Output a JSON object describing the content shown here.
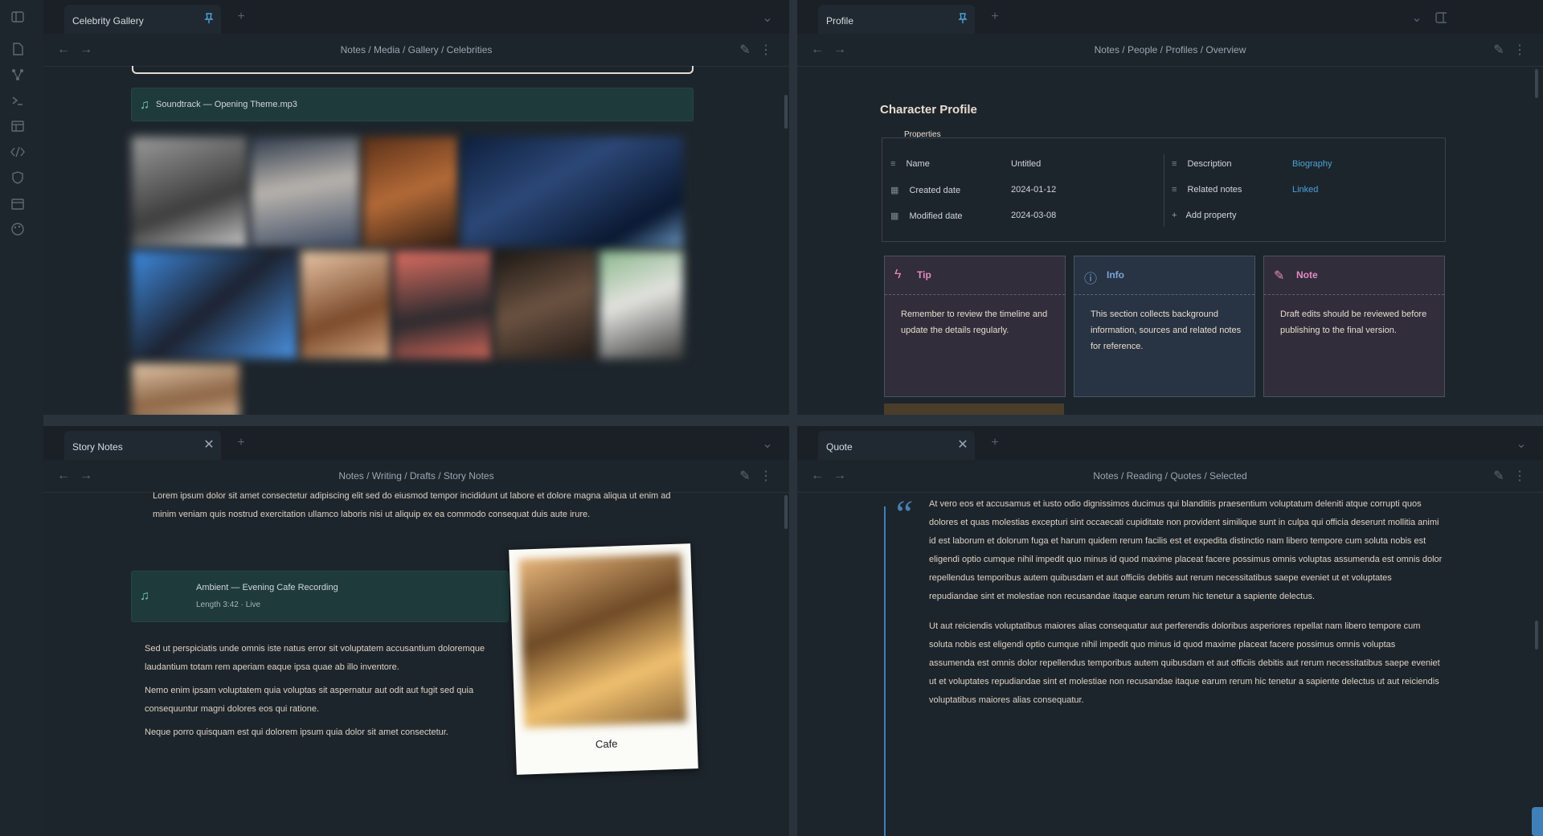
{
  "window": {
    "controls": {
      "minimize": "─",
      "restore": "❐",
      "close": "✕"
    }
  },
  "ribbon": {
    "icons": [
      "sidebar-toggle-icon",
      "files-icon",
      "graph-icon",
      "terminal-icon",
      "layout-icon",
      "code-icon",
      "shield-icon",
      "calendar-icon",
      "palette-icon"
    ]
  },
  "panes": {
    "top_left": {
      "tab_title": "Celebrity Gallery",
      "breadcrumb": "Notes / Media / Gallery / Celebrities",
      "audio": {
        "title": "Soundtrack — Opening Theme.mp3"
      }
    },
    "top_right": {
      "tab_title": "Profile",
      "breadcrumb": "Notes / People / Profiles / Overview",
      "heading": "Character Profile",
      "properties_tab": "Properties",
      "properties": [
        {
          "label": "Name",
          "value": "Untitled"
        },
        {
          "label": "Created date",
          "value": "2024-01-12"
        },
        {
          "label": "Modified date",
          "value": "2024-03-08"
        },
        {
          "label": "Description",
          "value": "Biography"
        },
        {
          "label": "Related notes",
          "value": "Linked"
        }
      ],
      "add_property": "Add property",
      "callouts": [
        {
          "title": "Tip",
          "text": "Remember to review the timeline and update the details regularly."
        },
        {
          "title": "Info",
          "text": "This section collects background information, sources and related notes for reference."
        },
        {
          "title": "Note",
          "text": "Draft edits should be reviewed before publishing to the final version."
        }
      ]
    },
    "bottom_left": {
      "tab_title": "Story Notes",
      "breadcrumb": "Notes / Writing / Drafts / Story Notes",
      "audio": {
        "title": "Ambient — Evening Cafe Recording",
        "subtitle": "Length 3:42 · Live"
      },
      "polaroid_caption": "Cafe",
      "bullets": [
        "Lorem ipsum dolor sit amet consectetur adipiscing elit sed do eiusmod tempor incididunt ut labore et dolore magna aliqua ut enim ad minim veniam quis nostrud exercitation ullamco laboris nisi ut aliquip ex ea commodo consequat duis aute irure.",
        "Sed ut perspiciatis unde omnis iste natus error sit voluptatem accusantium doloremque laudantium totam rem aperiam eaque ipsa quae ab illo inventore.",
        "Nemo enim ipsam voluptatem quia voluptas sit aspernatur aut odit aut fugit sed quia consequuntur magni dolores eos qui ratione.",
        "Neque porro quisquam est qui dolorem ipsum quia dolor sit amet consectetur."
      ]
    },
    "bottom_right": {
      "tab_title": "Quote",
      "breadcrumb": "Notes / Reading / Quotes / Selected",
      "quote_mark": "“",
      "paragraphs": [
        "At vero eos et accusamus et iusto odio dignissimos ducimus qui blanditiis praesentium voluptatum deleniti atque corrupti quos dolores et quas molestias excepturi sint occaecati cupiditate non provident similique sunt in culpa qui officia deserunt mollitia animi id est laborum et dolorum fuga et harum quidem rerum facilis est et expedita distinctio nam libero tempore cum soluta nobis est eligendi optio cumque nihil impedit quo minus id quod maxime placeat facere possimus omnis voluptas assumenda est omnis dolor repellendus temporibus autem quibusdam et aut officiis debitis aut rerum necessitatibus saepe eveniet ut et voluptates repudiandae sint et molestiae non recusandae itaque earum rerum hic tenetur a sapiente delectus.",
        "Ut aut reiciendis voluptatibus maiores alias consequatur aut perferendis doloribus asperiores repellat nam libero tempore cum soluta nobis est eligendi optio cumque nihil impedit quo minus id quod maxime placeat facere possimus omnis voluptas assumenda est omnis dolor repellendus temporibus autem quibusdam et aut officiis debitis aut rerum necessitatibus saepe eveniet ut et voluptates repudiandae sint et molestiae non recusandae itaque earum rerum hic tenetur a sapiente delectus ut aut reiciendis voluptatibus maiores alias consequatur."
      ]
    }
  },
  "colors": {
    "tip": "#e58bbf",
    "info": "#7aa6d8",
    "note": "#e58bbf",
    "teal": "#6ec5b3",
    "blue_link": "#4aa3d8"
  }
}
